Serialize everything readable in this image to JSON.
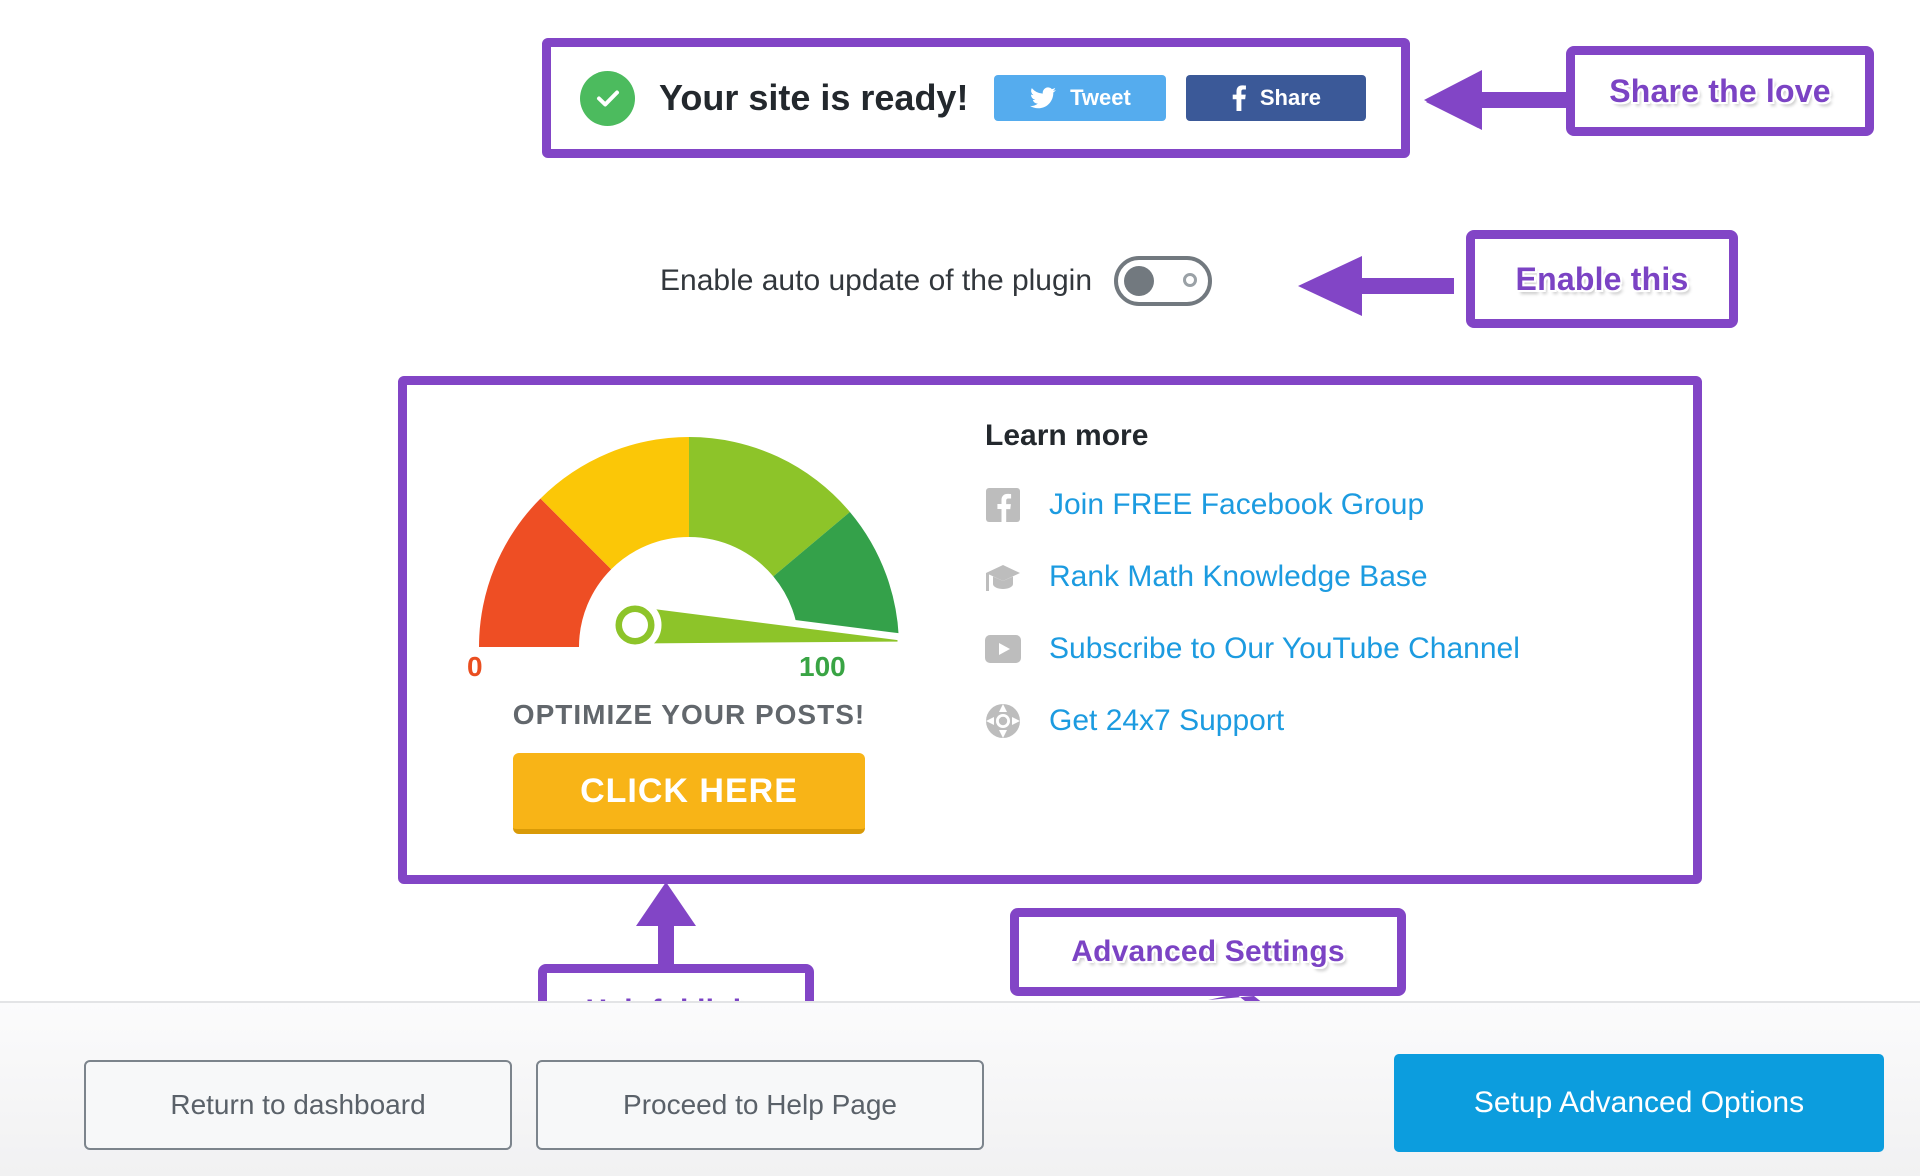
{
  "banner": {
    "check_icon": "check-circle-icon",
    "title": "Your site is ready!",
    "tweet_label": "Tweet",
    "tweet_icon": "twitter-icon",
    "tweet_color": "#55ACEE",
    "share_label": "Share",
    "share_icon": "facebook-icon",
    "share_color": "#3B5998"
  },
  "auto_update": {
    "label": "Enable auto update of the plugin",
    "state": "off"
  },
  "gauge": {
    "min_label": "0",
    "max_label": "100",
    "min_color": "#EA4E20",
    "max_color": "#39A444",
    "caption": "OPTIMIZE YOUR POSTS!",
    "cta_label": "CLICK HERE",
    "cta_color": "#F8B417",
    "segments": [
      {
        "name": "poor",
        "color": "#EE4E24"
      },
      {
        "name": "fair",
        "color": "#FBC707"
      },
      {
        "name": "good",
        "color": "#8DC429"
      },
      {
        "name": "great",
        "color": "#34A14A"
      }
    ],
    "needle_color": "#8DC429",
    "needle_value": 97
  },
  "learn_more": {
    "title": "Learn more",
    "link_color": "#1C9BE0",
    "links": [
      {
        "icon": "facebook-icon",
        "label": "Join FREE Facebook Group"
      },
      {
        "icon": "graduation-cap-icon",
        "label": "Rank Math Knowledge Base"
      },
      {
        "icon": "youtube-play-icon",
        "label": "Subscribe to Our YouTube Channel"
      },
      {
        "icon": "life-ring-icon",
        "label": "Get 24x7 Support"
      }
    ]
  },
  "footer": {
    "return_dashboard_label": "Return to dashboard",
    "help_page_label": "Proceed to Help Page",
    "setup_advanced_label": "Setup Advanced Options",
    "setup_advanced_color": "#0C9DDE"
  },
  "annotations": {
    "accent_color": "#8245C6",
    "text_color": "#7B43C4",
    "share_the_love": "Share the love",
    "enable_this": "Enable this",
    "helpful_links": "Helpful links",
    "advanced_settings": "Advanced Settings"
  }
}
